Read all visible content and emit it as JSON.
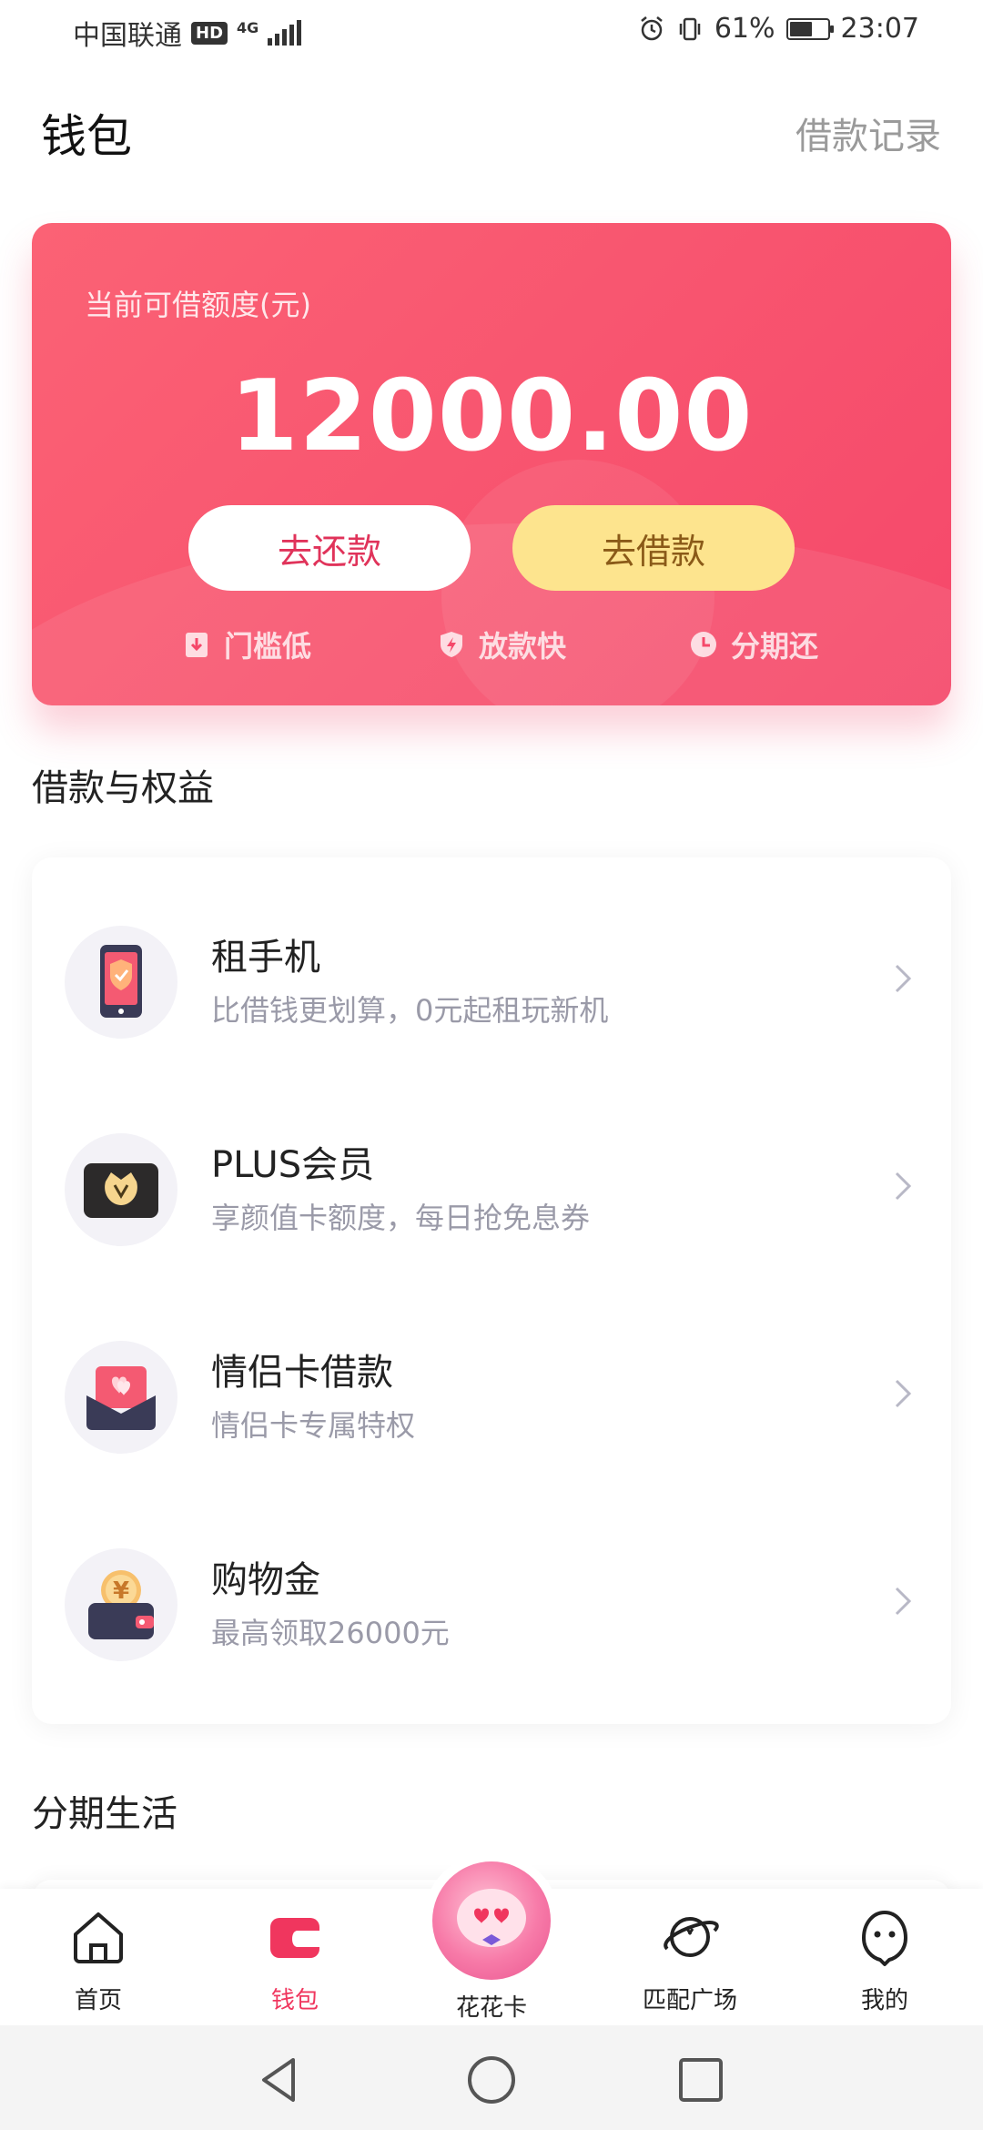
{
  "status_bar": {
    "carrier": "中国联通",
    "hd_badge": "HD",
    "network": "4G",
    "battery": "61%",
    "battery_level": 0.61,
    "time": "23:07"
  },
  "header": {
    "title": "钱包",
    "link": "借款记录"
  },
  "credit": {
    "label": "当前可借额度(元)",
    "amount": "12000.00",
    "repay_button": "去还款",
    "borrow_button": "去借款",
    "features": [
      {
        "label": "门槛低",
        "icon": "download-doc-icon"
      },
      {
        "label": "放款快",
        "icon": "lightning-shield-icon"
      },
      {
        "label": "分期还",
        "icon": "clock-icon"
      }
    ]
  },
  "benefits": {
    "title": "借款与权益",
    "items": [
      {
        "title": "租手机",
        "subtitle": "比借钱更划算，0元起租玩新机",
        "icon": "phone-shield-icon"
      },
      {
        "title": "PLUS会员",
        "subtitle": "享颜值卡额度，每日抢免息券",
        "icon": "vip-crown-card-icon"
      },
      {
        "title": "情侣卡借款",
        "subtitle": "情侣卡专属特权",
        "icon": "couple-hearts-card-icon"
      },
      {
        "title": "购物金",
        "subtitle": "最高领取26000元",
        "icon": "yen-wallet-icon"
      }
    ]
  },
  "life": {
    "title": "分期生活"
  },
  "bottom_nav": {
    "items": [
      {
        "label": "首页",
        "icon": "home-icon"
      },
      {
        "label": "钱包",
        "icon": "wallet-icon",
        "active": true
      },
      {
        "label": "花花卡",
        "icon": "mascot-icon"
      },
      {
        "label": "匹配广场",
        "icon": "planet-icon"
      },
      {
        "label": "我的",
        "icon": "profile-ghost-icon"
      }
    ]
  },
  "colors": {
    "brand": "#f5486a",
    "borrow_button": "#fde48e",
    "active_nav": "#f0365e"
  }
}
